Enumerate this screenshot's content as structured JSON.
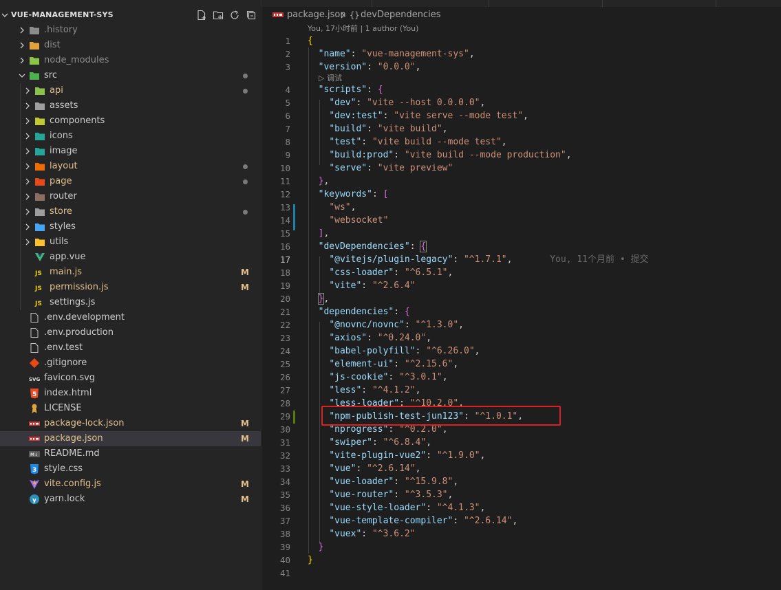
{
  "explorer": {
    "title": "VUE-MANAGEMENT-SYS",
    "actions": [
      "new-file-icon",
      "new-folder-icon",
      "refresh-icon",
      "collapse-all-icon"
    ],
    "items": [
      {
        "label": ".history",
        "type": "folder",
        "depth": 1,
        "icon": "folder-icon",
        "dim": true
      },
      {
        "label": "dist",
        "type": "folder",
        "depth": 1,
        "icon": "folder-dist-icon",
        "dim": true
      },
      {
        "label": "node_modules",
        "type": "folder",
        "depth": 1,
        "icon": "folder-node-icon",
        "dim": true
      },
      {
        "label": "src",
        "type": "folder-open",
        "depth": 1,
        "icon": "folder-src-icon",
        "status": "dot"
      },
      {
        "label": "api",
        "type": "folder",
        "depth": 2,
        "icon": "folder-api-icon",
        "status": "dot",
        "modified": true
      },
      {
        "label": "assets",
        "type": "folder",
        "depth": 2,
        "icon": "folder-assets-icon"
      },
      {
        "label": "components",
        "type": "folder",
        "depth": 2,
        "icon": "folder-components-icon"
      },
      {
        "label": "icons",
        "type": "folder",
        "depth": 2,
        "icon": "folder-icons-icon"
      },
      {
        "label": "image",
        "type": "folder",
        "depth": 2,
        "icon": "folder-image-icon"
      },
      {
        "label": "layout",
        "type": "folder",
        "depth": 2,
        "icon": "folder-layout-icon",
        "status": "dot",
        "modified": true
      },
      {
        "label": "page",
        "type": "folder",
        "depth": 2,
        "icon": "folder-page-icon",
        "status": "dot",
        "modified": true
      },
      {
        "label": "router",
        "type": "folder",
        "depth": 2,
        "icon": "folder-router-icon"
      },
      {
        "label": "store",
        "type": "folder",
        "depth": 2,
        "icon": "folder-store-icon",
        "status": "dot",
        "modified": true
      },
      {
        "label": "styles",
        "type": "folder",
        "depth": 2,
        "icon": "folder-styles-icon"
      },
      {
        "label": "utils",
        "type": "folder",
        "depth": 2,
        "icon": "folder-utils-icon"
      },
      {
        "label": "app.vue",
        "type": "file",
        "depth": 2,
        "icon": "vue-file-icon"
      },
      {
        "label": "main.js",
        "type": "file",
        "depth": 2,
        "icon": "js-file-icon",
        "status": "M",
        "modified": true
      },
      {
        "label": "permission.js",
        "type": "file",
        "depth": 2,
        "icon": "js-file-icon",
        "status": "M",
        "modified": true
      },
      {
        "label": "settings.js",
        "type": "file",
        "depth": 2,
        "icon": "js-file-icon"
      },
      {
        "label": ".env.development",
        "type": "file",
        "depth": 1,
        "icon": "env-file-icon"
      },
      {
        "label": ".env.production",
        "type": "file",
        "depth": 1,
        "icon": "env-file-icon"
      },
      {
        "label": ".env.test",
        "type": "file",
        "depth": 1,
        "icon": "env-file-icon"
      },
      {
        "label": ".gitignore",
        "type": "file",
        "depth": 1,
        "icon": "git-file-icon"
      },
      {
        "label": "favicon.svg",
        "type": "file",
        "depth": 1,
        "icon": "svg-file-icon"
      },
      {
        "label": "index.html",
        "type": "file",
        "depth": 1,
        "icon": "html-file-icon"
      },
      {
        "label": "LICENSE",
        "type": "file",
        "depth": 1,
        "icon": "license-file-icon"
      },
      {
        "label": "package-lock.json",
        "type": "file",
        "depth": 1,
        "icon": "npm-file-icon",
        "status": "M",
        "modified": true
      },
      {
        "label": "package.json",
        "type": "file",
        "depth": 1,
        "icon": "npm-file-icon",
        "status": "M",
        "modified": true,
        "selected": true
      },
      {
        "label": "README.md",
        "type": "file",
        "depth": 1,
        "icon": "markdown-file-icon"
      },
      {
        "label": "style.css",
        "type": "file",
        "depth": 1,
        "icon": "css-file-icon"
      },
      {
        "label": "vite.config.js",
        "type": "file",
        "depth": 1,
        "icon": "vite-file-icon",
        "status": "M",
        "modified": true
      },
      {
        "label": "yarn.lock",
        "type": "file",
        "depth": 1,
        "icon": "yarn-file-icon",
        "status": "M"
      }
    ]
  },
  "breadcrumb": {
    "file": "package.json",
    "symbol_icon": "{}",
    "symbol": "devDependencies"
  },
  "codelens": {
    "author": "You, 17小时前 | 1 author (You)",
    "debug": "调试"
  },
  "colors": {
    "key": "#9cdcfe",
    "string": "#ce9178",
    "bracket_gold": "#ffd700",
    "bracket_purple": "#da70d6",
    "bracket_blue": "#179fff",
    "modified": "#e2c08d",
    "git_added": "#587c0c",
    "git_modified": "#1b81a8",
    "highlight_box": "#e02020"
  },
  "code": {
    "active_line": 17,
    "lines": [
      {
        "n": "1",
        "t": [
          [
            "b1",
            "{"
          ]
        ]
      },
      {
        "n": "2",
        "t": [
          [
            "p",
            "  "
          ],
          [
            "k",
            "\"name\""
          ],
          [
            "p",
            ": "
          ],
          [
            "s",
            "\"vue-management-sys\""
          ],
          [
            "p",
            ","
          ]
        ]
      },
      {
        "n": "3",
        "t": [
          [
            "p",
            "  "
          ],
          [
            "k",
            "\"version\""
          ],
          [
            "p",
            ": "
          ],
          [
            "s",
            "\"0.0.0\""
          ],
          [
            "p",
            ","
          ]
        ]
      },
      {
        "n": "",
        "lens": true
      },
      {
        "n": "4",
        "t": [
          [
            "p",
            "  "
          ],
          [
            "k",
            "\"scripts\""
          ],
          [
            "p",
            ": "
          ],
          [
            "b2",
            "{"
          ]
        ]
      },
      {
        "n": "5",
        "t": [
          [
            "p",
            "    "
          ],
          [
            "k",
            "\"dev\""
          ],
          [
            "p",
            ": "
          ],
          [
            "s",
            "\"vite --host 0.0.0.0\""
          ],
          [
            "p",
            ","
          ]
        ]
      },
      {
        "n": "6",
        "t": [
          [
            "p",
            "    "
          ],
          [
            "k",
            "\"dev:test\""
          ],
          [
            "p",
            ": "
          ],
          [
            "s",
            "\"vite serve --mode test\""
          ],
          [
            "p",
            ","
          ]
        ]
      },
      {
        "n": "7",
        "t": [
          [
            "p",
            "    "
          ],
          [
            "k",
            "\"build\""
          ],
          [
            "p",
            ": "
          ],
          [
            "s",
            "\"vite build\""
          ],
          [
            "p",
            ","
          ]
        ]
      },
      {
        "n": "8",
        "t": [
          [
            "p",
            "    "
          ],
          [
            "k",
            "\"test\""
          ],
          [
            "p",
            ": "
          ],
          [
            "s",
            "\"vite build --mode test\""
          ],
          [
            "p",
            ","
          ]
        ]
      },
      {
        "n": "9",
        "t": [
          [
            "p",
            "    "
          ],
          [
            "k",
            "\"build:prod\""
          ],
          [
            "p",
            ": "
          ],
          [
            "s",
            "\"vite build --mode production\""
          ],
          [
            "p",
            ","
          ]
        ]
      },
      {
        "n": "10",
        "t": [
          [
            "p",
            "    "
          ],
          [
            "k",
            "\"serve\""
          ],
          [
            "p",
            ": "
          ],
          [
            "s",
            "\"vite preview\""
          ]
        ]
      },
      {
        "n": "11",
        "t": [
          [
            "p",
            "  "
          ],
          [
            "b2",
            "}"
          ],
          [
            "p",
            ","
          ]
        ]
      },
      {
        "n": "12",
        "t": [
          [
            "p",
            "  "
          ],
          [
            "k",
            "\"keywords\""
          ],
          [
            "p",
            ": "
          ],
          [
            "b2",
            "["
          ]
        ]
      },
      {
        "n": "13",
        "t": [
          [
            "p",
            "    "
          ],
          [
            "s",
            "\"ws\""
          ],
          [
            "p",
            ","
          ]
        ]
      },
      {
        "n": "14",
        "t": [
          [
            "p",
            "    "
          ],
          [
            "s",
            "\"websocket\""
          ]
        ]
      },
      {
        "n": "15",
        "t": [
          [
            "p",
            "  "
          ],
          [
            "b2",
            "]"
          ],
          [
            "p",
            ","
          ]
        ]
      },
      {
        "n": "16",
        "t": [
          [
            "p",
            "  "
          ],
          [
            "k",
            "\"devDependencies\""
          ],
          [
            "p",
            ": "
          ],
          [
            "b2m",
            "{"
          ]
        ]
      },
      {
        "n": "17",
        "t": [
          [
            "p",
            "    "
          ],
          [
            "k",
            "\"@vitejs/plugin-legacy\""
          ],
          [
            "p",
            ": "
          ],
          [
            "s",
            "\"^1.7.1\""
          ],
          [
            "p",
            ","
          ],
          [
            "blame",
            "       You, 11个月前 • 提交"
          ]
        ]
      },
      {
        "n": "18",
        "t": [
          [
            "p",
            "    "
          ],
          [
            "k",
            "\"css-loader\""
          ],
          [
            "p",
            ": "
          ],
          [
            "s",
            "\"^6.5.1\""
          ],
          [
            "p",
            ","
          ]
        ]
      },
      {
        "n": "19",
        "t": [
          [
            "p",
            "    "
          ],
          [
            "k",
            "\"vite\""
          ],
          [
            "p",
            ": "
          ],
          [
            "s",
            "\"^2.6.4\""
          ]
        ]
      },
      {
        "n": "20",
        "t": [
          [
            "p",
            "  "
          ],
          [
            "b2m",
            "}"
          ],
          [
            "p",
            ","
          ]
        ]
      },
      {
        "n": "21",
        "t": [
          [
            "p",
            "  "
          ],
          [
            "k",
            "\"dependencies\""
          ],
          [
            "p",
            ": "
          ],
          [
            "b2",
            "{"
          ]
        ]
      },
      {
        "n": "22",
        "t": [
          [
            "p",
            "    "
          ],
          [
            "k",
            "\"@novnc/novnc\""
          ],
          [
            "p",
            ": "
          ],
          [
            "s",
            "\"^1.3.0\""
          ],
          [
            "p",
            ","
          ]
        ]
      },
      {
        "n": "23",
        "t": [
          [
            "p",
            "    "
          ],
          [
            "k",
            "\"axios\""
          ],
          [
            "p",
            ": "
          ],
          [
            "s",
            "\"^0.24.0\""
          ],
          [
            "p",
            ","
          ]
        ]
      },
      {
        "n": "24",
        "t": [
          [
            "p",
            "    "
          ],
          [
            "k",
            "\"babel-polyfill\""
          ],
          [
            "p",
            ": "
          ],
          [
            "s",
            "\"^6.26.0\""
          ],
          [
            "p",
            ","
          ]
        ]
      },
      {
        "n": "25",
        "t": [
          [
            "p",
            "    "
          ],
          [
            "k",
            "\"element-ui\""
          ],
          [
            "p",
            ": "
          ],
          [
            "s",
            "\"^2.15.6\""
          ],
          [
            "p",
            ","
          ]
        ]
      },
      {
        "n": "26",
        "t": [
          [
            "p",
            "    "
          ],
          [
            "k",
            "\"js-cookie\""
          ],
          [
            "p",
            ": "
          ],
          [
            "s",
            "\"^3.0.1\""
          ],
          [
            "p",
            ","
          ]
        ]
      },
      {
        "n": "27",
        "t": [
          [
            "p",
            "    "
          ],
          [
            "k",
            "\"less\""
          ],
          [
            "p",
            ": "
          ],
          [
            "s",
            "\"^4.1.2\""
          ],
          [
            "p",
            ","
          ]
        ]
      },
      {
        "n": "28",
        "t": [
          [
            "p",
            "    "
          ],
          [
            "k",
            "\"less-loader\""
          ],
          [
            "p",
            ": "
          ],
          [
            "s",
            "\"^10.2.0\""
          ],
          [
            "p",
            ","
          ]
        ]
      },
      {
        "n": "29",
        "t": [
          [
            "p",
            "    "
          ],
          [
            "k",
            "\"npm-publish-test-jun123\""
          ],
          [
            "p",
            ": "
          ],
          [
            "s",
            "\"^1.0.1\""
          ],
          [
            "p",
            ","
          ]
        ]
      },
      {
        "n": "30",
        "t": [
          [
            "p",
            "    "
          ],
          [
            "k",
            "\"nprogress\""
          ],
          [
            "p",
            ": "
          ],
          [
            "s",
            "\"^0.2.0\""
          ],
          [
            "p",
            ","
          ]
        ]
      },
      {
        "n": "31",
        "t": [
          [
            "p",
            "    "
          ],
          [
            "k",
            "\"swiper\""
          ],
          [
            "p",
            ": "
          ],
          [
            "s",
            "\"^6.8.4\""
          ],
          [
            "p",
            ","
          ]
        ]
      },
      {
        "n": "32",
        "t": [
          [
            "p",
            "    "
          ],
          [
            "k",
            "\"vite-plugin-vue2\""
          ],
          [
            "p",
            ": "
          ],
          [
            "s",
            "\"^1.9.0\""
          ],
          [
            "p",
            ","
          ]
        ]
      },
      {
        "n": "33",
        "t": [
          [
            "p",
            "    "
          ],
          [
            "k",
            "\"vue\""
          ],
          [
            "p",
            ": "
          ],
          [
            "s",
            "\"^2.6.14\""
          ],
          [
            "p",
            ","
          ]
        ]
      },
      {
        "n": "34",
        "t": [
          [
            "p",
            "    "
          ],
          [
            "k",
            "\"vue-loader\""
          ],
          [
            "p",
            ": "
          ],
          [
            "s",
            "\"^15.9.8\""
          ],
          [
            "p",
            ","
          ]
        ]
      },
      {
        "n": "35",
        "t": [
          [
            "p",
            "    "
          ],
          [
            "k",
            "\"vue-router\""
          ],
          [
            "p",
            ": "
          ],
          [
            "s",
            "\"^3.5.3\""
          ],
          [
            "p",
            ","
          ]
        ]
      },
      {
        "n": "36",
        "t": [
          [
            "p",
            "    "
          ],
          [
            "k",
            "\"vue-style-loader\""
          ],
          [
            "p",
            ": "
          ],
          [
            "s",
            "\"^4.1.3\""
          ],
          [
            "p",
            ","
          ]
        ]
      },
      {
        "n": "37",
        "t": [
          [
            "p",
            "    "
          ],
          [
            "k",
            "\"vue-template-compiler\""
          ],
          [
            "p",
            ": "
          ],
          [
            "s",
            "\"^2.6.14\""
          ],
          [
            "p",
            ","
          ]
        ]
      },
      {
        "n": "38",
        "t": [
          [
            "p",
            "    "
          ],
          [
            "k",
            "\"vuex\""
          ],
          [
            "p",
            ": "
          ],
          [
            "s",
            "\"^3.6.2\""
          ]
        ]
      },
      {
        "n": "39",
        "t": [
          [
            "p",
            "  "
          ],
          [
            "b2",
            "}"
          ]
        ]
      },
      {
        "n": "40",
        "t": [
          [
            "b1",
            "}"
          ]
        ]
      },
      {
        "n": "41",
        "t": []
      }
    ]
  }
}
